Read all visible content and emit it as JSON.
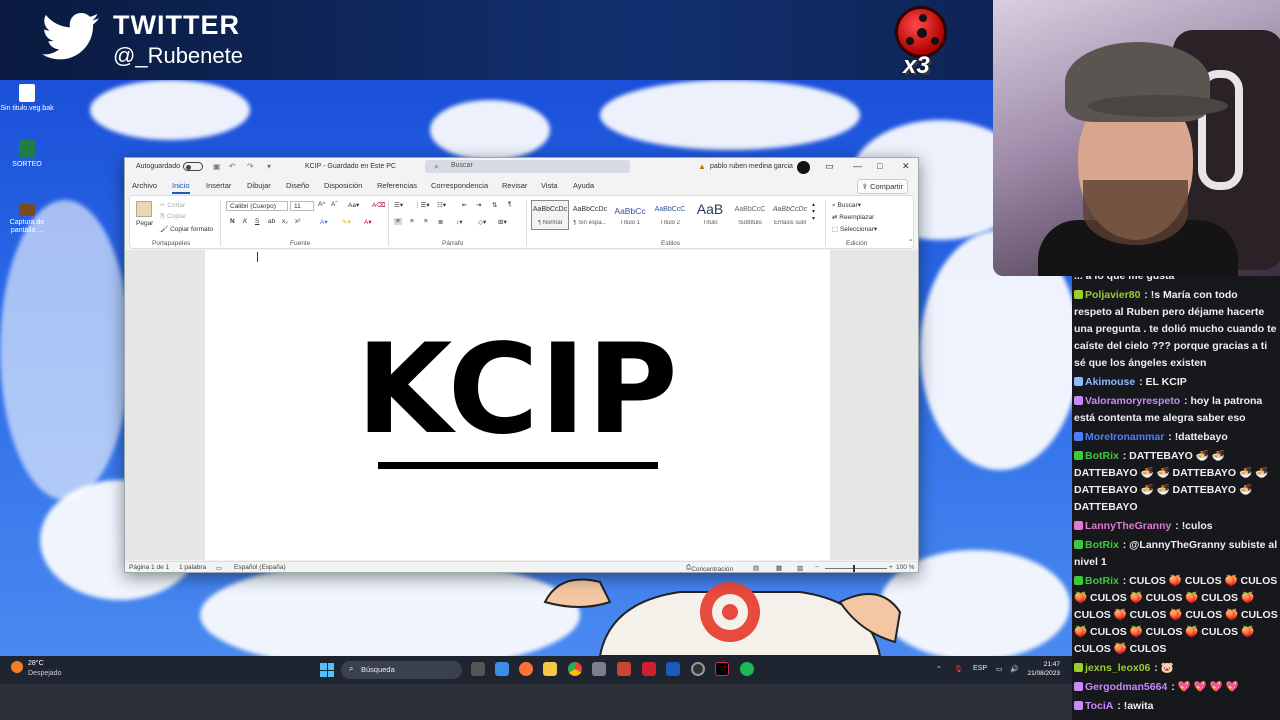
{
  "overlay": {
    "title": "TWITTER",
    "handle": "@_Rubenete",
    "multiplier": "x3",
    "twitter_icon": "twitter-bird-icon",
    "accent": "#1d9bf0"
  },
  "desktop": {
    "icons": [
      {
        "label": "Sin titulo.veg.bak",
        "icon": "file-icon"
      },
      {
        "label": "SORTEO",
        "icon": "spreadsheet-icon"
      },
      {
        "label": "Captura de pantalla ...",
        "icon": "folder-icon"
      }
    ]
  },
  "word": {
    "autosave_label": "Autoguardado",
    "doc_title": "KCIP - Guardado en Este PC",
    "search_placeholder": "Buscar",
    "user_name": "pablo ruben medina garcia",
    "tabs": [
      "Archivo",
      "Inicio",
      "Insertar",
      "Dibujar",
      "Diseño",
      "Disposición",
      "Referencias",
      "Correspondencia",
      "Revisar",
      "Vista",
      "Ayuda"
    ],
    "active_tab": "Inicio",
    "share_label": "Compartir",
    "ribbon": {
      "clipboard": {
        "paste": "Pegar",
        "cut": "Cortar",
        "copy": "Copiar",
        "format_painter": "Copiar formato",
        "label": "Portapapeles"
      },
      "font": {
        "name": "Calibri (Cuerpo)",
        "size": "11",
        "label": "Fuente"
      },
      "paragraph": {
        "label": "Párrafo"
      },
      "styles": {
        "label": "Estilos",
        "items": [
          {
            "preview": "AaBbCcDc",
            "name": "¶ Normal"
          },
          {
            "preview": "AaBbCcDc",
            "name": "¶ Sin espa..."
          },
          {
            "preview": "AaBbCc",
            "name": "Título 1"
          },
          {
            "preview": "AaBbCcC",
            "name": "Título 2"
          },
          {
            "preview": "AaB",
            "name": "Título"
          },
          {
            "preview": "AaBbCcC",
            "name": "Subtítulo"
          },
          {
            "preview": "AaBbCcDc",
            "name": "Énfasis sutil"
          }
        ]
      },
      "editing": {
        "find": "Buscar",
        "replace": "Reemplazar",
        "select": "Seleccionar",
        "label": "Edición"
      }
    },
    "document_text": "KCIP",
    "status": {
      "page": "Página 1 de 1",
      "words": "1 palabra",
      "language": "Español (España)",
      "focus": "Concentración",
      "zoom": "100 %"
    }
  },
  "taskbar": {
    "temperature": "28°C",
    "weather": "Despejado",
    "search_label": "Búsqueda",
    "lang": "ESP",
    "time": "21:47",
    "date": "21/08/2023"
  },
  "chat": {
    "messages": [
      {
        "user": "",
        "text": "... a lo que me gusta",
        "color": "#efeff1"
      },
      {
        "user": "Poljavier80",
        "text": ": !s María con todo respeto al Ruben pero déjame hacerte una pregunta . te dolió mucho cuando te caíste del cielo ??? porque gracias a ti sé que los ángeles existen",
        "color": "#9acd32"
      },
      {
        "user": "Akimouse",
        "text": ": EL KCIP",
        "color": "#8fb8ff"
      },
      {
        "user": "Valoramoryrespeto",
        "text": ": hoy la patrona está contenta me alegra saber eso",
        "color": "#c58af9"
      },
      {
        "user": "MoreIronammar",
        "text": ": !dattebayo",
        "color": "#4f7cff"
      },
      {
        "user": "BotRix",
        "text": ": DATTEBAYO 🍜 🍜 DATTEBAYO 🍜 🍜 DATTEBAYO 🍜 🍜 DATTEBAYO 🍜 🍜 DATTEBAYO 🍜 DATTEBAYO",
        "color": "#3cc93c"
      },
      {
        "user": "LannyTheGranny",
        "text": ": !culos",
        "color": "#e07ad0"
      },
      {
        "user": "BotRix",
        "text": ": @LannyTheGranny subiste al nivel 1",
        "color": "#3cc93c"
      },
      {
        "user": "BotRix",
        "text": ": CULOS 🍑 CULOS 🍑 CULOS 🍑 CULOS 🍑 CULOS 🍑 CULOS 🍑 CULOS 🍑 CULOS 🍑 CULOS 🍑 CULOS 🍑 CULOS 🍑 CULOS 🍑 CULOS 🍑 CULOS 🍑 CULOS",
        "color": "#3cc93c"
      },
      {
        "user": "jexns_leox06",
        "text": ": 🐷",
        "color": "#9acd32"
      },
      {
        "user": "Gergodman5664",
        "text": ": 💖 💖 💖 💖",
        "color": "#c58af9"
      },
      {
        "user": "TociA",
        "text": ": !awita",
        "color": "#c58af9"
      }
    ]
  }
}
